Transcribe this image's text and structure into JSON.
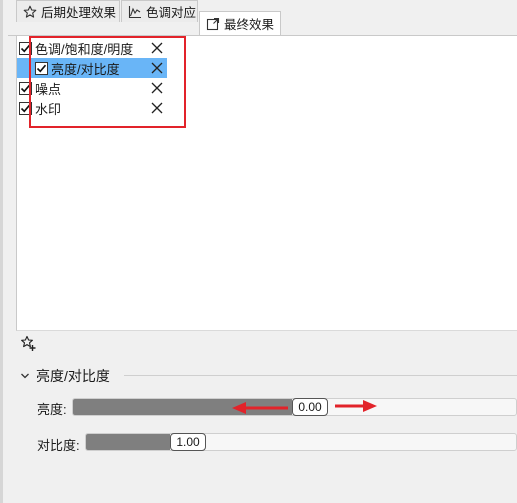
{
  "tabs": [
    {
      "label": "后期处理效果",
      "icon": "star-icon",
      "active": false
    },
    {
      "label": "色调对应",
      "icon": "curve-chart-icon",
      "active": false
    },
    {
      "label": "最终效果",
      "icon": "export-icon",
      "active": true
    }
  ],
  "effects": [
    {
      "label": "色调/饱和度/明度",
      "checked": true,
      "selected": false
    },
    {
      "label": "亮度/对比度",
      "checked": true,
      "selected": true
    },
    {
      "label": "噪点",
      "checked": true,
      "selected": false
    },
    {
      "label": "水印",
      "checked": true,
      "selected": false
    }
  ],
  "section": {
    "title": "亮度/对比度"
  },
  "sliders": [
    {
      "label": "亮度:",
      "value": "0.00",
      "fraction": 0.5
    },
    {
      "label": "对比度:",
      "value": "1.00",
      "fraction": 0.19
    }
  ],
  "colors": {
    "selection": "#69b5f7",
    "highlight_box": "#e2232a",
    "slider_fill": "#7f7f7f"
  }
}
